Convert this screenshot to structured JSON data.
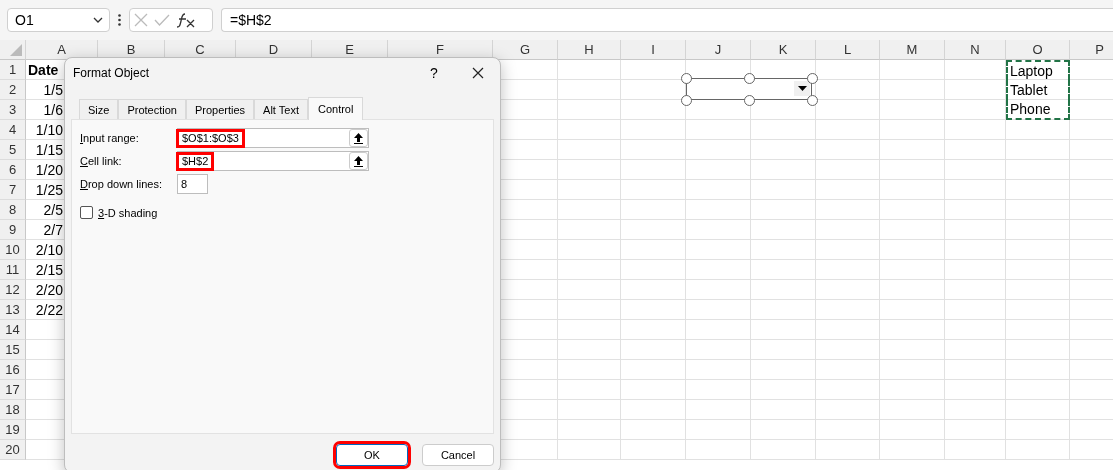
{
  "name_box": {
    "value": "O1"
  },
  "formula_bar": {
    "value": "=$H$2"
  },
  "sheet": {
    "columns": [
      "A",
      "B",
      "C",
      "D",
      "E",
      "F",
      "G",
      "H",
      "I",
      "J",
      "K",
      "L",
      "M",
      "N",
      "O",
      "P"
    ],
    "rows": [
      {
        "number": "1",
        "column_a": "Date",
        "bold": true,
        "column_o": "Laptop",
        "in_marquee": true
      },
      {
        "number": "2",
        "column_a": "1/5",
        "bold": false,
        "column_o": "Tablet",
        "in_marquee": true
      },
      {
        "number": "3",
        "column_a": "1/6",
        "bold": false,
        "column_o": "Phone",
        "in_marquee": true
      },
      {
        "number": "4",
        "column_a": "1/10",
        "bold": false
      },
      {
        "number": "5",
        "column_a": "1/15",
        "bold": false
      },
      {
        "number": "6",
        "column_a": "1/20",
        "bold": false
      },
      {
        "number": "7",
        "column_a": "1/25",
        "bold": false
      },
      {
        "number": "8",
        "column_a": "2/5",
        "bold": false
      },
      {
        "number": "9",
        "column_a": "2/7",
        "bold": false
      },
      {
        "number": "10",
        "column_a": "2/10",
        "bold": false
      },
      {
        "number": "11",
        "column_a": "2/15",
        "bold": false
      },
      {
        "number": "12",
        "column_a": "2/20",
        "bold": false
      },
      {
        "number": "13",
        "column_a": "2/22",
        "bold": false
      },
      {
        "number": "14"
      },
      {
        "number": "15"
      },
      {
        "number": "16"
      },
      {
        "number": "17"
      },
      {
        "number": "18"
      },
      {
        "number": "19"
      },
      {
        "number": "20"
      }
    ]
  },
  "dialog": {
    "title": "Format Object",
    "help": "?",
    "tabs": [
      {
        "label": "Size",
        "selected": false
      },
      {
        "label": "Protection",
        "selected": false
      },
      {
        "label": "Properties",
        "selected": false
      },
      {
        "label": "Alt Text",
        "selected": false
      },
      {
        "label": "Control",
        "selected": true
      }
    ],
    "fields": [
      {
        "kind": "range",
        "label": "Input range:",
        "value": "$O$1:$O$3",
        "highlighted": true
      },
      {
        "kind": "range",
        "label": "Cell link:",
        "value": "$H$2",
        "highlighted": true
      },
      {
        "kind": "number",
        "label": "Drop down lines:",
        "value": "8",
        "highlighted": false
      }
    ],
    "checkbox": {
      "label": "3-D shading",
      "checked": false
    },
    "buttons": [
      {
        "label": "OK",
        "highlighted": true
      },
      {
        "label": "Cancel",
        "highlighted": false
      }
    ]
  }
}
